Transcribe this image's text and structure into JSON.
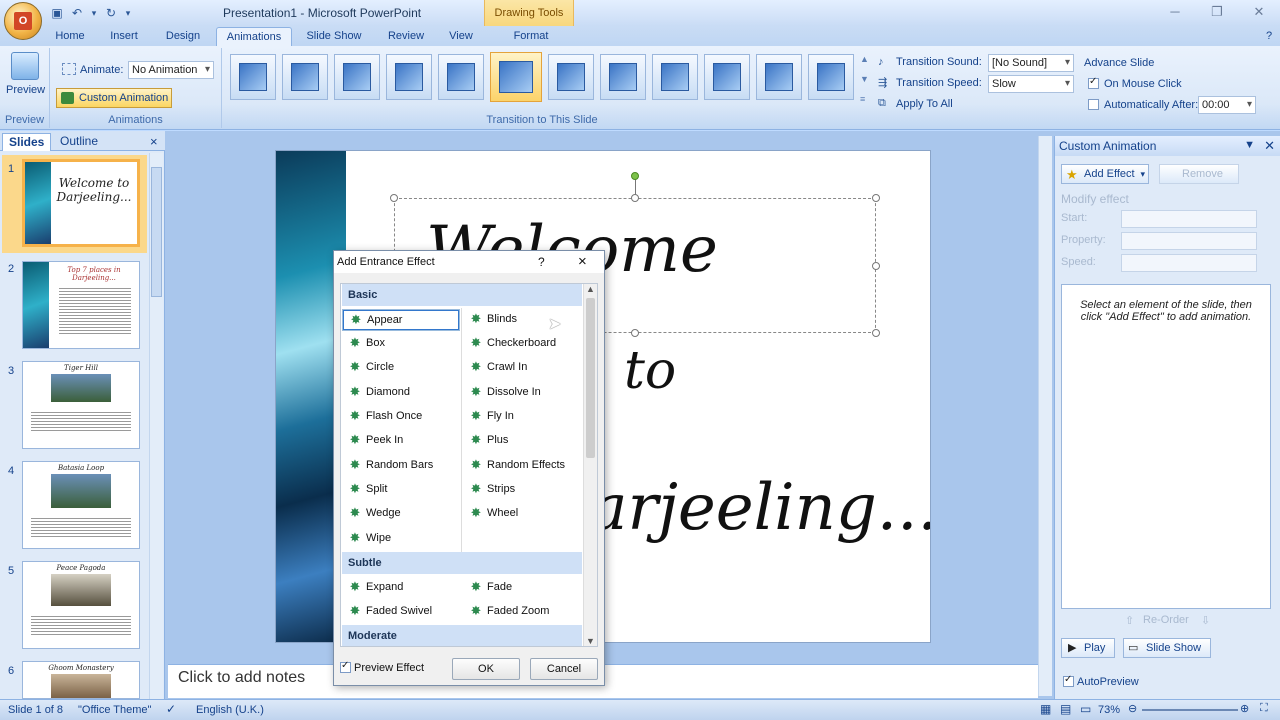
{
  "app": {
    "window_title": "Presentation1 - Microsoft PowerPoint",
    "context_tab": "Drawing Tools",
    "office_button": "O"
  },
  "ribbon_tabs": [
    "Home",
    "Insert",
    "Design",
    "Animations",
    "Slide Show",
    "Review",
    "View",
    "Format"
  ],
  "preview": {
    "label": "Preview",
    "group": "Preview"
  },
  "animations": {
    "animate_label": "Animate:",
    "animate_value": "No Animation",
    "custom_label": "Custom Animation",
    "group": "Animations"
  },
  "transition": {
    "group": "Transition to This Slide",
    "sound_label": "Transition Sound:",
    "sound_value": "[No Sound]",
    "speed_label": "Transition Speed:",
    "speed_value": "Slow",
    "apply_label": "Apply To All",
    "advance_label": "Advance Slide",
    "mouse_label": "On Mouse Click",
    "auto_label": "Automatically After:",
    "auto_value": "00:00"
  },
  "left_panel": {
    "tabs": [
      "Slides",
      "Outline"
    ],
    "close": "×",
    "slides": [
      {
        "num": "1",
        "title": "Welcome to Darjeeling..."
      },
      {
        "num": "2",
        "title": "Top 7 places in Darjeeling..."
      },
      {
        "num": "3",
        "title": "Tiger Hill"
      },
      {
        "num": "4",
        "title": "Batasia Loop"
      },
      {
        "num": "5",
        "title": "Peace Pagoda"
      },
      {
        "num": "6",
        "title": "Ghoom Monastery"
      }
    ]
  },
  "slide": {
    "line1": "Welcome",
    "line2": "to",
    "line3": "Darjeeling..."
  },
  "notes": {
    "placeholder": "Click to add notes"
  },
  "task_pane": {
    "title": "Custom Animation",
    "add_effect": "Add Effect",
    "remove": "Remove",
    "modify": "Modify effect",
    "start": "Start:",
    "property": "Property:",
    "speed": "Speed:",
    "hint": "Select an element of the slide, then click \"Add Effect\" to add animation.",
    "reorder": "Re-Order",
    "play": "Play",
    "slideshow": "Slide Show",
    "autopreview": "AutoPreview"
  },
  "status": {
    "slide": "Slide 1 of 8",
    "theme": "\"Office Theme\"",
    "language": "English (U.K.)",
    "zoom": "73%"
  },
  "dialog": {
    "title": "Add Entrance Effect",
    "help": "?",
    "close": "×",
    "categories": [
      "Basic",
      "Subtle",
      "Moderate"
    ],
    "basic_left": [
      "Appear",
      "Box",
      "Circle",
      "Diamond",
      "Flash Once",
      "Peek In",
      "Random Bars",
      "Split",
      "Wedge",
      "Wipe"
    ],
    "basic_right": [
      "Blinds",
      "Checkerboard",
      "Crawl In",
      "Dissolve In",
      "Fly In",
      "Plus",
      "Random Effects",
      "Strips",
      "Wheel"
    ],
    "subtle_left": [
      "Expand",
      "Faded Swivel"
    ],
    "subtle_right": [
      "Fade",
      "Faded Zoom"
    ],
    "preview_label": "Preview Effect",
    "ok": "OK",
    "cancel": "Cancel"
  }
}
